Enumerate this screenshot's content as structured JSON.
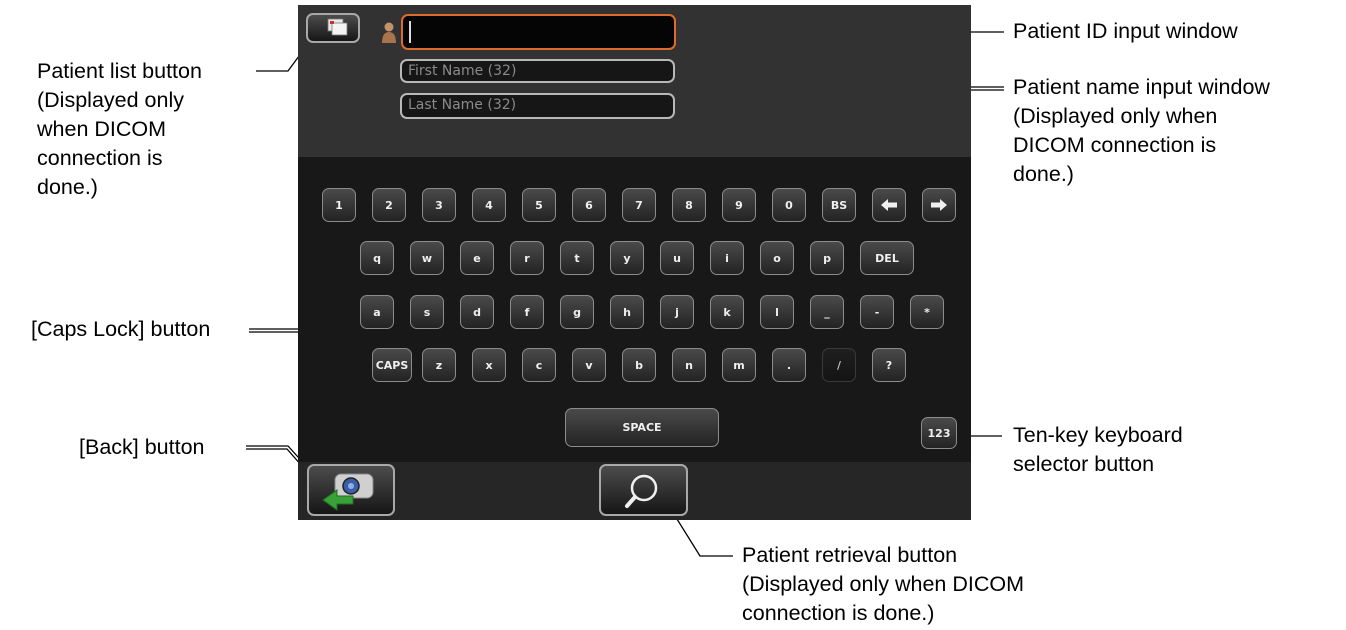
{
  "screen": {
    "fields": {
      "patient_id_value": "",
      "first_name_placeholder": "First Name (32)",
      "last_name_placeholder": "Last Name (32)"
    },
    "keyboard": {
      "row1": [
        "1",
        "2",
        "3",
        "4",
        "5",
        "6",
        "7",
        "8",
        "9",
        "0",
        "BS"
      ],
      "row1_arrows": [
        "left-arrow-icon",
        "right-arrow-icon"
      ],
      "row2": [
        "q",
        "w",
        "e",
        "r",
        "t",
        "y",
        "u",
        "i",
        "o",
        "p",
        "DEL"
      ],
      "row3": [
        "a",
        "s",
        "d",
        "f",
        "g",
        "h",
        "j",
        "k",
        "l",
        "_",
        "-",
        "*"
      ],
      "row4": [
        "CAPS",
        "z",
        "x",
        "c",
        "v",
        "b",
        "n",
        "m",
        ".",
        "/",
        "?"
      ],
      "space": "SPACE",
      "tenkey": "123"
    },
    "icons": {
      "patient_list": "patient-list-icon",
      "person": "person-icon",
      "back": "back-camera-icon",
      "search": "search-icon"
    },
    "colors": {
      "id_field_border": "#e06a2c",
      "back_arrow": "#3aa03a"
    }
  },
  "annotations": {
    "patient_list_button": [
      "Patient list button",
      "(Displayed only",
      "when DICOM",
      "connection is",
      "done.)"
    ],
    "caps_lock_button": [
      "[Caps Lock] button"
    ],
    "back_button": [
      "[Back] button"
    ],
    "patient_id_window": [
      "Patient ID input window"
    ],
    "patient_name_window": [
      "Patient name input window",
      "(Displayed only when",
      "DICOM connection is",
      "done.)"
    ],
    "ten_key_selector": [
      "Ten-key keyboard",
      "selector button"
    ],
    "patient_retrieval_button": [
      "Patient retrieval button",
      "(Displayed only when DICOM",
      "connection is done.)"
    ]
  }
}
